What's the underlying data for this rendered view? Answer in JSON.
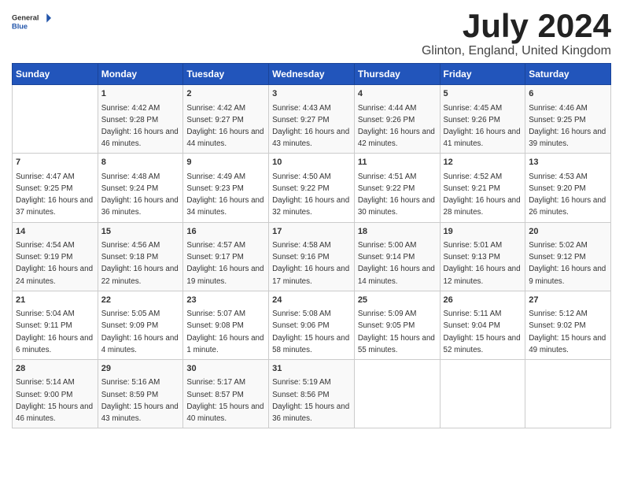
{
  "header": {
    "logo_general": "General",
    "logo_blue": "Blue",
    "month_year": "July 2024",
    "location": "Glinton, England, United Kingdom"
  },
  "days_of_week": [
    "Sunday",
    "Monday",
    "Tuesday",
    "Wednesday",
    "Thursday",
    "Friday",
    "Saturday"
  ],
  "weeks": [
    [
      {
        "day": "",
        "info": ""
      },
      {
        "day": "1",
        "info": "Sunrise: 4:42 AM\nSunset: 9:28 PM\nDaylight: 16 hours and 46 minutes."
      },
      {
        "day": "2",
        "info": "Sunrise: 4:42 AM\nSunset: 9:27 PM\nDaylight: 16 hours and 44 minutes."
      },
      {
        "day": "3",
        "info": "Sunrise: 4:43 AM\nSunset: 9:27 PM\nDaylight: 16 hours and 43 minutes."
      },
      {
        "day": "4",
        "info": "Sunrise: 4:44 AM\nSunset: 9:26 PM\nDaylight: 16 hours and 42 minutes."
      },
      {
        "day": "5",
        "info": "Sunrise: 4:45 AM\nSunset: 9:26 PM\nDaylight: 16 hours and 41 minutes."
      },
      {
        "day": "6",
        "info": "Sunrise: 4:46 AM\nSunset: 9:25 PM\nDaylight: 16 hours and 39 minutes."
      }
    ],
    [
      {
        "day": "7",
        "info": "Sunrise: 4:47 AM\nSunset: 9:25 PM\nDaylight: 16 hours and 37 minutes."
      },
      {
        "day": "8",
        "info": "Sunrise: 4:48 AM\nSunset: 9:24 PM\nDaylight: 16 hours and 36 minutes."
      },
      {
        "day": "9",
        "info": "Sunrise: 4:49 AM\nSunset: 9:23 PM\nDaylight: 16 hours and 34 minutes."
      },
      {
        "day": "10",
        "info": "Sunrise: 4:50 AM\nSunset: 9:22 PM\nDaylight: 16 hours and 32 minutes."
      },
      {
        "day": "11",
        "info": "Sunrise: 4:51 AM\nSunset: 9:22 PM\nDaylight: 16 hours and 30 minutes."
      },
      {
        "day": "12",
        "info": "Sunrise: 4:52 AM\nSunset: 9:21 PM\nDaylight: 16 hours and 28 minutes."
      },
      {
        "day": "13",
        "info": "Sunrise: 4:53 AM\nSunset: 9:20 PM\nDaylight: 16 hours and 26 minutes."
      }
    ],
    [
      {
        "day": "14",
        "info": "Sunrise: 4:54 AM\nSunset: 9:19 PM\nDaylight: 16 hours and 24 minutes."
      },
      {
        "day": "15",
        "info": "Sunrise: 4:56 AM\nSunset: 9:18 PM\nDaylight: 16 hours and 22 minutes."
      },
      {
        "day": "16",
        "info": "Sunrise: 4:57 AM\nSunset: 9:17 PM\nDaylight: 16 hours and 19 minutes."
      },
      {
        "day": "17",
        "info": "Sunrise: 4:58 AM\nSunset: 9:16 PM\nDaylight: 16 hours and 17 minutes."
      },
      {
        "day": "18",
        "info": "Sunrise: 5:00 AM\nSunset: 9:14 PM\nDaylight: 16 hours and 14 minutes."
      },
      {
        "day": "19",
        "info": "Sunrise: 5:01 AM\nSunset: 9:13 PM\nDaylight: 16 hours and 12 minutes."
      },
      {
        "day": "20",
        "info": "Sunrise: 5:02 AM\nSunset: 9:12 PM\nDaylight: 16 hours and 9 minutes."
      }
    ],
    [
      {
        "day": "21",
        "info": "Sunrise: 5:04 AM\nSunset: 9:11 PM\nDaylight: 16 hours and 6 minutes."
      },
      {
        "day": "22",
        "info": "Sunrise: 5:05 AM\nSunset: 9:09 PM\nDaylight: 16 hours and 4 minutes."
      },
      {
        "day": "23",
        "info": "Sunrise: 5:07 AM\nSunset: 9:08 PM\nDaylight: 16 hours and 1 minute."
      },
      {
        "day": "24",
        "info": "Sunrise: 5:08 AM\nSunset: 9:06 PM\nDaylight: 15 hours and 58 minutes."
      },
      {
        "day": "25",
        "info": "Sunrise: 5:09 AM\nSunset: 9:05 PM\nDaylight: 15 hours and 55 minutes."
      },
      {
        "day": "26",
        "info": "Sunrise: 5:11 AM\nSunset: 9:04 PM\nDaylight: 15 hours and 52 minutes."
      },
      {
        "day": "27",
        "info": "Sunrise: 5:12 AM\nSunset: 9:02 PM\nDaylight: 15 hours and 49 minutes."
      }
    ],
    [
      {
        "day": "28",
        "info": "Sunrise: 5:14 AM\nSunset: 9:00 PM\nDaylight: 15 hours and 46 minutes."
      },
      {
        "day": "29",
        "info": "Sunrise: 5:16 AM\nSunset: 8:59 PM\nDaylight: 15 hours and 43 minutes."
      },
      {
        "day": "30",
        "info": "Sunrise: 5:17 AM\nSunset: 8:57 PM\nDaylight: 15 hours and 40 minutes."
      },
      {
        "day": "31",
        "info": "Sunrise: 5:19 AM\nSunset: 8:56 PM\nDaylight: 15 hours and 36 minutes."
      },
      {
        "day": "",
        "info": ""
      },
      {
        "day": "",
        "info": ""
      },
      {
        "day": "",
        "info": ""
      }
    ]
  ]
}
